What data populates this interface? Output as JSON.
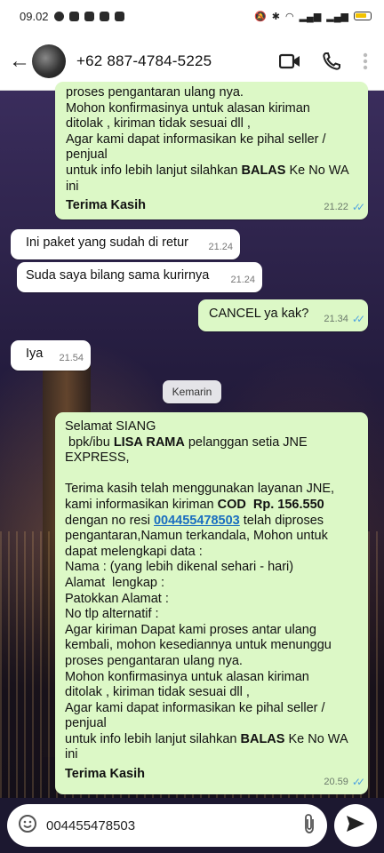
{
  "status_bar": {
    "time": "09.02",
    "icons": [
      "whatsapp-icon",
      "messenger-icon",
      "youtube-icon",
      "phone-app-icon",
      "maps-icon"
    ],
    "right_icons": [
      "mute-icon",
      "bluetooth-icon",
      "wifi-icon",
      "signal-icon",
      "signal-icon",
      "battery-icon"
    ]
  },
  "header": {
    "contact_name": "+62 887-4784-5225",
    "icons": [
      "back-arrow-icon",
      "video-call-icon",
      "phone-call-icon",
      "more-vert-icon"
    ]
  },
  "messages": [
    {
      "direction": "out",
      "lines": [
        "proses pengantaran ulang nya.",
        "Mohon konfirmasinya untuk alasan kiriman",
        "ditolak , kiriman tidak sesuai dll ,",
        "Agar kami dapat informasikan ke pihal seller /",
        "penjual",
        "untuk info lebih lanjut silahkan ",
        "ini",
        "Terima Kasih"
      ],
      "bold_inline": "BALAS",
      "after_bold": " Ke No WA",
      "time": "21.22"
    },
    {
      "direction": "in",
      "text": "Ini paket yang sudah di retur",
      "time": "21.24"
    },
    {
      "direction": "in",
      "text": "Suda saya bilang sama kurirnya",
      "time": "21.24"
    },
    {
      "direction": "out",
      "text": "CANCEL ya kak?",
      "time": "21.34"
    },
    {
      "direction": "in",
      "text": "Iya",
      "time": "21.54"
    }
  ],
  "date_chip": "Kemarin",
  "long_message": {
    "l1": "Selamat SIANG",
    "l2a": " bpk/ibu ",
    "l2b": "LISA RAMA",
    "l2c": " pelanggan setia JNE",
    "l3": "EXPRESS,",
    "l4": "Terima kasih telah menggunakan layanan JNE,",
    "l5a": "kami informasikan kiriman ",
    "l5b": "COD  Rp. 156.550",
    "l6a": "dengan no resi ",
    "l6b": "004455478503",
    "l6c": " telah diproses",
    "l7": "pengantaran,Namun terkandala, Mohon untuk",
    "l8": "dapat melengkapi data :",
    "l9": "Nama : (yang lebih dikenal sehari - hari)",
    "l10": "Alamat  lengkap :",
    "l11": "Patokkan Alamat :",
    "l12": "No tlp alternatif :",
    "l13": "Agar kiriman Dapat kami proses antar ulang",
    "l14": "kembali, mohon kesediannya untuk menunggu",
    "l15": "proses pengantaran ulang nya.",
    "l16": "Mohon konfirmasinya untuk alasan kiriman",
    "l17": "ditolak , kiriman tidak sesuai dll ,",
    "l18": "Agar kami dapat informasikan ke pihal seller /",
    "l19": "penjual",
    "l20a": "untuk info lebih lanjut silahkan ",
    "l20b": "BALAS",
    "l20c": " Ke No WA",
    "l21": "ini",
    "l22": "Terima Kasih",
    "time": "20.59"
  },
  "input": {
    "value": "004455478503",
    "icons": [
      "emoji-icon",
      "attach-icon",
      "send-icon"
    ]
  },
  "colors": {
    "outgoing_bubble": "#dcf8c6",
    "incoming_bubble": "#ffffff",
    "read_tick": "#4fa3e0",
    "link": "#1a6ec0"
  }
}
